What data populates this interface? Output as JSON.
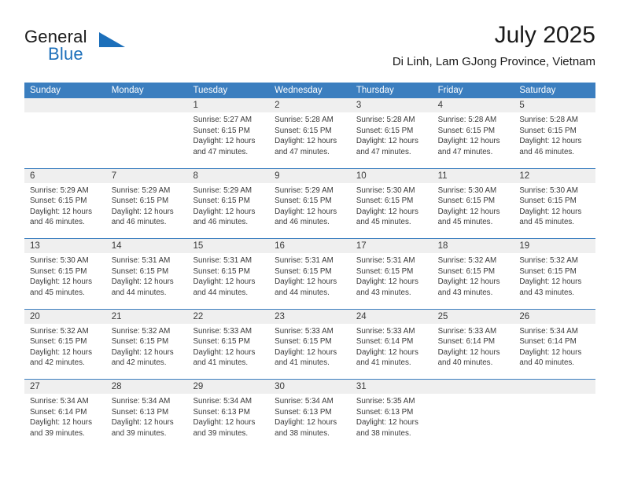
{
  "brand": {
    "name_part1": "General",
    "name_part2": "Blue",
    "accent_color": "#1c6fba"
  },
  "header": {
    "title": "July 2025",
    "subtitle": "Di Linh, Lam GJong Province, Vietnam"
  },
  "theme": {
    "header_bar_color": "#3b7ebf",
    "date_strip_color": "#efefef",
    "row_separator_color": "#3b7ebf",
    "text_color": "#3a3a3a"
  },
  "weekdays": [
    "Sunday",
    "Monday",
    "Tuesday",
    "Wednesday",
    "Thursday",
    "Friday",
    "Saturday"
  ],
  "weeks": [
    [
      {
        "day": "",
        "empty": true,
        "sunrise": "",
        "sunset": "",
        "daylight_line1": "",
        "daylight_line2": ""
      },
      {
        "day": "",
        "empty": true,
        "sunrise": "",
        "sunset": "",
        "daylight_line1": "",
        "daylight_line2": ""
      },
      {
        "day": "1",
        "empty": false,
        "sunrise": "Sunrise: 5:27 AM",
        "sunset": "Sunset: 6:15 PM",
        "daylight_line1": "Daylight: 12 hours",
        "daylight_line2": "and 47 minutes."
      },
      {
        "day": "2",
        "empty": false,
        "sunrise": "Sunrise: 5:28 AM",
        "sunset": "Sunset: 6:15 PM",
        "daylight_line1": "Daylight: 12 hours",
        "daylight_line2": "and 47 minutes."
      },
      {
        "day": "3",
        "empty": false,
        "sunrise": "Sunrise: 5:28 AM",
        "sunset": "Sunset: 6:15 PM",
        "daylight_line1": "Daylight: 12 hours",
        "daylight_line2": "and 47 minutes."
      },
      {
        "day": "4",
        "empty": false,
        "sunrise": "Sunrise: 5:28 AM",
        "sunset": "Sunset: 6:15 PM",
        "daylight_line1": "Daylight: 12 hours",
        "daylight_line2": "and 47 minutes."
      },
      {
        "day": "5",
        "empty": false,
        "sunrise": "Sunrise: 5:28 AM",
        "sunset": "Sunset: 6:15 PM",
        "daylight_line1": "Daylight: 12 hours",
        "daylight_line2": "and 46 minutes."
      }
    ],
    [
      {
        "day": "6",
        "empty": false,
        "sunrise": "Sunrise: 5:29 AM",
        "sunset": "Sunset: 6:15 PM",
        "daylight_line1": "Daylight: 12 hours",
        "daylight_line2": "and 46 minutes."
      },
      {
        "day": "7",
        "empty": false,
        "sunrise": "Sunrise: 5:29 AM",
        "sunset": "Sunset: 6:15 PM",
        "daylight_line1": "Daylight: 12 hours",
        "daylight_line2": "and 46 minutes."
      },
      {
        "day": "8",
        "empty": false,
        "sunrise": "Sunrise: 5:29 AM",
        "sunset": "Sunset: 6:15 PM",
        "daylight_line1": "Daylight: 12 hours",
        "daylight_line2": "and 46 minutes."
      },
      {
        "day": "9",
        "empty": false,
        "sunrise": "Sunrise: 5:29 AM",
        "sunset": "Sunset: 6:15 PM",
        "daylight_line1": "Daylight: 12 hours",
        "daylight_line2": "and 46 minutes."
      },
      {
        "day": "10",
        "empty": false,
        "sunrise": "Sunrise: 5:30 AM",
        "sunset": "Sunset: 6:15 PM",
        "daylight_line1": "Daylight: 12 hours",
        "daylight_line2": "and 45 minutes."
      },
      {
        "day": "11",
        "empty": false,
        "sunrise": "Sunrise: 5:30 AM",
        "sunset": "Sunset: 6:15 PM",
        "daylight_line1": "Daylight: 12 hours",
        "daylight_line2": "and 45 minutes."
      },
      {
        "day": "12",
        "empty": false,
        "sunrise": "Sunrise: 5:30 AM",
        "sunset": "Sunset: 6:15 PM",
        "daylight_line1": "Daylight: 12 hours",
        "daylight_line2": "and 45 minutes."
      }
    ],
    [
      {
        "day": "13",
        "empty": false,
        "sunrise": "Sunrise: 5:30 AM",
        "sunset": "Sunset: 6:15 PM",
        "daylight_line1": "Daylight: 12 hours",
        "daylight_line2": "and 45 minutes."
      },
      {
        "day": "14",
        "empty": false,
        "sunrise": "Sunrise: 5:31 AM",
        "sunset": "Sunset: 6:15 PM",
        "daylight_line1": "Daylight: 12 hours",
        "daylight_line2": "and 44 minutes."
      },
      {
        "day": "15",
        "empty": false,
        "sunrise": "Sunrise: 5:31 AM",
        "sunset": "Sunset: 6:15 PM",
        "daylight_line1": "Daylight: 12 hours",
        "daylight_line2": "and 44 minutes."
      },
      {
        "day": "16",
        "empty": false,
        "sunrise": "Sunrise: 5:31 AM",
        "sunset": "Sunset: 6:15 PM",
        "daylight_line1": "Daylight: 12 hours",
        "daylight_line2": "and 44 minutes."
      },
      {
        "day": "17",
        "empty": false,
        "sunrise": "Sunrise: 5:31 AM",
        "sunset": "Sunset: 6:15 PM",
        "daylight_line1": "Daylight: 12 hours",
        "daylight_line2": "and 43 minutes."
      },
      {
        "day": "18",
        "empty": false,
        "sunrise": "Sunrise: 5:32 AM",
        "sunset": "Sunset: 6:15 PM",
        "daylight_line1": "Daylight: 12 hours",
        "daylight_line2": "and 43 minutes."
      },
      {
        "day": "19",
        "empty": false,
        "sunrise": "Sunrise: 5:32 AM",
        "sunset": "Sunset: 6:15 PM",
        "daylight_line1": "Daylight: 12 hours",
        "daylight_line2": "and 43 minutes."
      }
    ],
    [
      {
        "day": "20",
        "empty": false,
        "sunrise": "Sunrise: 5:32 AM",
        "sunset": "Sunset: 6:15 PM",
        "daylight_line1": "Daylight: 12 hours",
        "daylight_line2": "and 42 minutes."
      },
      {
        "day": "21",
        "empty": false,
        "sunrise": "Sunrise: 5:32 AM",
        "sunset": "Sunset: 6:15 PM",
        "daylight_line1": "Daylight: 12 hours",
        "daylight_line2": "and 42 minutes."
      },
      {
        "day": "22",
        "empty": false,
        "sunrise": "Sunrise: 5:33 AM",
        "sunset": "Sunset: 6:15 PM",
        "daylight_line1": "Daylight: 12 hours",
        "daylight_line2": "and 41 minutes."
      },
      {
        "day": "23",
        "empty": false,
        "sunrise": "Sunrise: 5:33 AM",
        "sunset": "Sunset: 6:15 PM",
        "daylight_line1": "Daylight: 12 hours",
        "daylight_line2": "and 41 minutes."
      },
      {
        "day": "24",
        "empty": false,
        "sunrise": "Sunrise: 5:33 AM",
        "sunset": "Sunset: 6:14 PM",
        "daylight_line1": "Daylight: 12 hours",
        "daylight_line2": "and 41 minutes."
      },
      {
        "day": "25",
        "empty": false,
        "sunrise": "Sunrise: 5:33 AM",
        "sunset": "Sunset: 6:14 PM",
        "daylight_line1": "Daylight: 12 hours",
        "daylight_line2": "and 40 minutes."
      },
      {
        "day": "26",
        "empty": false,
        "sunrise": "Sunrise: 5:34 AM",
        "sunset": "Sunset: 6:14 PM",
        "daylight_line1": "Daylight: 12 hours",
        "daylight_line2": "and 40 minutes."
      }
    ],
    [
      {
        "day": "27",
        "empty": false,
        "sunrise": "Sunrise: 5:34 AM",
        "sunset": "Sunset: 6:14 PM",
        "daylight_line1": "Daylight: 12 hours",
        "daylight_line2": "and 39 minutes."
      },
      {
        "day": "28",
        "empty": false,
        "sunrise": "Sunrise: 5:34 AM",
        "sunset": "Sunset: 6:13 PM",
        "daylight_line1": "Daylight: 12 hours",
        "daylight_line2": "and 39 minutes."
      },
      {
        "day": "29",
        "empty": false,
        "sunrise": "Sunrise: 5:34 AM",
        "sunset": "Sunset: 6:13 PM",
        "daylight_line1": "Daylight: 12 hours",
        "daylight_line2": "and 39 minutes."
      },
      {
        "day": "30",
        "empty": false,
        "sunrise": "Sunrise: 5:34 AM",
        "sunset": "Sunset: 6:13 PM",
        "daylight_line1": "Daylight: 12 hours",
        "daylight_line2": "and 38 minutes."
      },
      {
        "day": "31",
        "empty": false,
        "sunrise": "Sunrise: 5:35 AM",
        "sunset": "Sunset: 6:13 PM",
        "daylight_line1": "Daylight: 12 hours",
        "daylight_line2": "and 38 minutes."
      },
      {
        "day": "",
        "empty": true,
        "sunrise": "",
        "sunset": "",
        "daylight_line1": "",
        "daylight_line2": ""
      },
      {
        "day": "",
        "empty": true,
        "sunrise": "",
        "sunset": "",
        "daylight_line1": "",
        "daylight_line2": ""
      }
    ]
  ]
}
